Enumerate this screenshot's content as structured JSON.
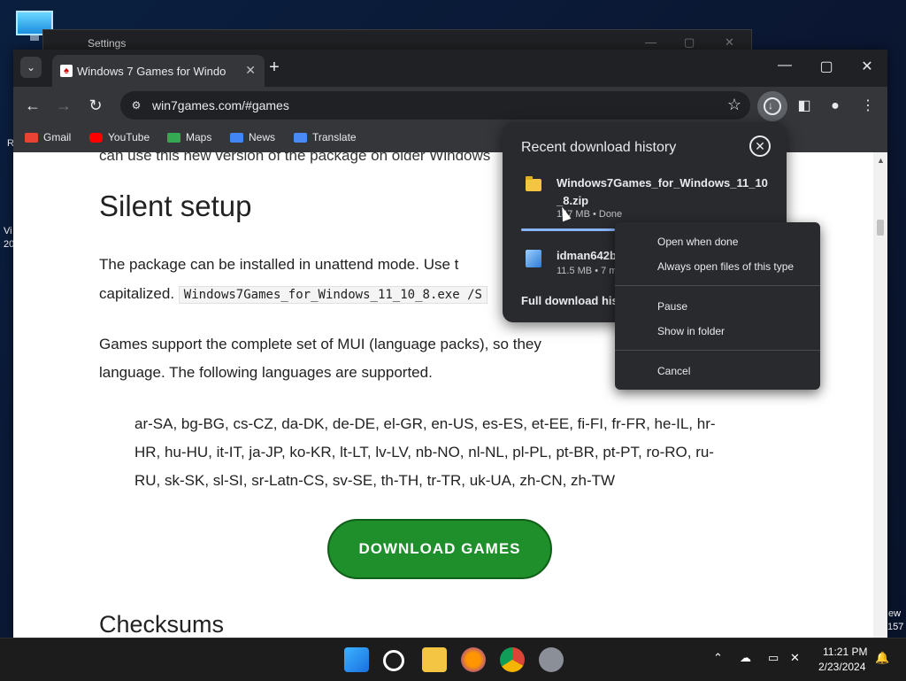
{
  "desktop": {
    "left_edge_text_1": "R",
    "left_edge_text_2": "Vi",
    "left_edge_text_3": "20",
    "right_edge_text_1": "ew",
    "right_edge_text_2": "157"
  },
  "bg_window": {
    "title": "Settings"
  },
  "browser": {
    "tab_title": "Windows 7 Games for Windows",
    "url": "win7games.com/#games",
    "bookmarks": [
      "Gmail",
      "YouTube",
      "Maps",
      "News",
      "Translate"
    ]
  },
  "page": {
    "cut_top_text": "can use this new version of the package on older Windows",
    "section_title": "Silent setup",
    "para1_a": "The package can be installed in unattend mode. Use t",
    "para1_b": "capitalized.",
    "code": "Windows7Games_for_Windows_11_10_8.exe /S",
    "para2_a": "Games support the complete set of MUI (language packs), so they",
    "para2_b": "language. The following languages are supported.",
    "languages_1": "ar-SA, bg-BG, cs-CZ, da-DK, de-DE, el-GR, en-US, es-ES, et-EE, fi-FI, fr-FR, he-IL, hr-",
    "languages_2": "HR, hu-HU, it-IT, ja-JP, ko-KR, lt-LT, lv-LV, nb-NO, nl-NL, pl-PL, pt-BR, pt-PT, ro-RO, ru-",
    "languages_3": "RU, sk-SK, sl-SI, sr-Latn-CS, sv-SE, th-TH, tr-TR, uk-UA, zh-CN, zh-TW",
    "download_button": "DOWNLOAD GAMES",
    "checksums_title": "Checksums"
  },
  "download_panel": {
    "title": "Recent download history",
    "item1_name": "Windows7Games_for_Windows_11_10_8.zip",
    "item1_status": "147 MB • Done",
    "item1_progress": 0.33,
    "item2_name": "idman642b",
    "item2_status": "11.5 MB • 7 m",
    "full_history": "Full download hist"
  },
  "context_menu": {
    "items": [
      "Open when done",
      "Always open files of this type",
      "Pause",
      "Show in folder",
      "Cancel"
    ]
  },
  "taskbar": {
    "time": "11:21 PM",
    "date": "2/23/2024"
  },
  "colors": {
    "chrome_dark": "#202124",
    "download_green": "#1e8f2b"
  }
}
